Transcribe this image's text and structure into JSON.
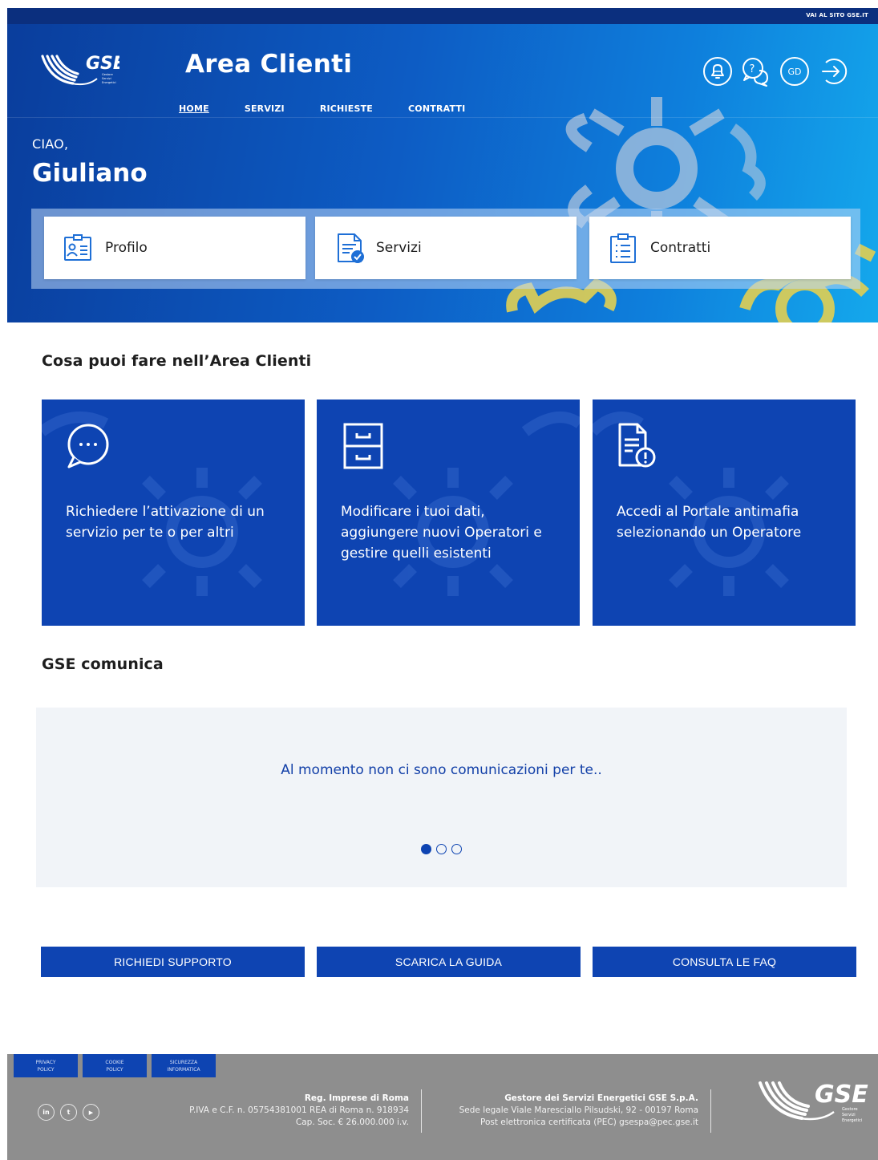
{
  "topbar": {
    "link": "VAI AL SITO GSE.IT"
  },
  "header": {
    "title": "Area Clienti",
    "logo_text": "GSE",
    "logo_sub": [
      "Gestore",
      "Servizi",
      "Energetici"
    ],
    "user_initials": "GD",
    "icons": [
      "notification-bell-icon",
      "help-icon",
      "user-avatar",
      "logout-icon"
    ]
  },
  "nav": [
    {
      "label": "HOME",
      "active": true
    },
    {
      "label": "SERVIZI",
      "active": false
    },
    {
      "label": "RICHIESTE",
      "active": false
    },
    {
      "label": "CONTRATTI",
      "active": false
    }
  ],
  "greeting": {
    "hello": "CIAO,",
    "name": "Giuliano"
  },
  "quick_links": [
    {
      "label": "Profilo",
      "icon": "profile-card-icon"
    },
    {
      "label": "Servizi",
      "icon": "service-document-icon"
    },
    {
      "label": "Contratti",
      "icon": "contract-list-icon"
    }
  ],
  "section_features": {
    "title": "Cosa puoi fare nell’Area Clienti"
  },
  "features": [
    {
      "text": "Richiedere l’attivazione di un servizio per te o per altri",
      "icon": "chat-bubble-icon"
    },
    {
      "text": "Modificare i tuoi dati, aggiungere nuovi Operatori e gestire quelli esistenti",
      "icon": "filing-cabinet-icon"
    },
    {
      "text": "Accedi al Portale antimafia selezionando un Operatore",
      "icon": "document-alert-icon"
    }
  ],
  "section_comm": {
    "title": "GSE comunica",
    "empty_text": "Al momento non ci sono comunicazioni per te..",
    "slide_count": 3,
    "active_slide": 1
  },
  "buttons": [
    {
      "label": "RICHIEDI SUPPORTO"
    },
    {
      "label": "SCARICA LA GUIDA"
    },
    {
      "label": "CONSULTA LE FAQ"
    }
  ],
  "footer": {
    "links": [
      {
        "line1": "PRIVACY",
        "line2": "POLICY"
      },
      {
        "line1": "COOKIE",
        "line2": "POLICY"
      },
      {
        "line1": "SICUREZZA",
        "line2": "INFORMATICA"
      }
    ],
    "social": [
      "in",
      "t",
      "▶"
    ],
    "col1": {
      "title": "Reg. Imprese di Roma",
      "line1": "P.IVA e C.F. n. 05754381001 REA di Roma n. 918934",
      "line2": "Cap. Soc. € 26.000.000 i.v."
    },
    "col2": {
      "title": "Gestore dei Servizi Energetici GSE S.p.A.",
      "line1": "Sede legale Viale Maresciallo Pilsudski, 92 - 00197 Roma",
      "line2": "Post elettronica certificata (PEC) gsespa@pec.gse.it"
    },
    "logo_text": "GSE",
    "logo_sub": [
      "Gestore",
      "Servizi",
      "Energetici"
    ]
  },
  "colors": {
    "primary": "#0e44b2",
    "header_dark": "#0a3d9c",
    "header_light": "#14a8ec",
    "footer_bg": "#8e8e8e",
    "comm_bg": "#f1f4f8"
  }
}
